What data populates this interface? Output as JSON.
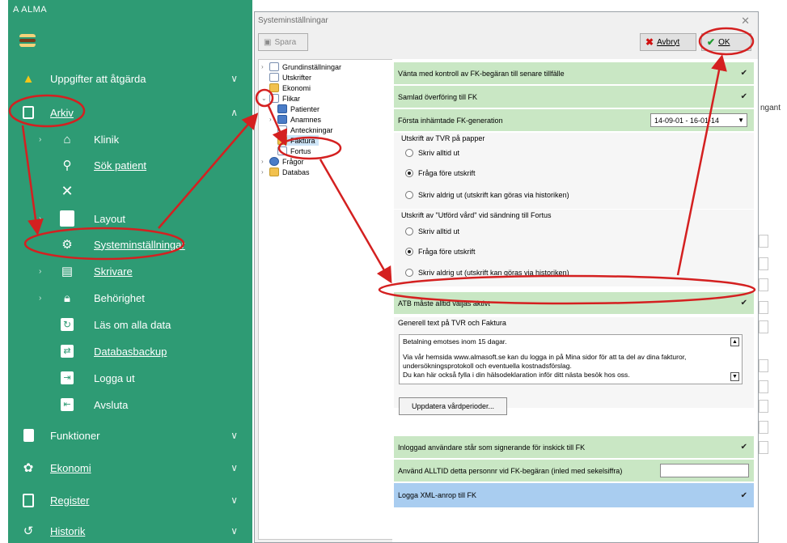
{
  "app": {
    "title": "A  ALMA"
  },
  "sidebar": {
    "sections": [
      {
        "label": "Uppgifter att åtgärda",
        "icon": "warning-icon"
      },
      {
        "label": "Arkiv",
        "icon": "archive-icon"
      }
    ],
    "arkiv_items": [
      {
        "label": "Klinik",
        "icon": "home-icon"
      },
      {
        "label": "Sök patient",
        "icon": "search-icon"
      },
      {
        "label": "",
        "icon": "close-icon"
      },
      {
        "label": "Layout",
        "icon": "layout-icon"
      },
      {
        "label": "Systeminställningar",
        "icon": "gear-icon"
      },
      {
        "label": "Skrivare",
        "icon": "printer-icon"
      },
      {
        "label": "Behörighet",
        "icon": "lock-icon"
      },
      {
        "label": "Läs om alla data",
        "icon": "refresh-icon"
      },
      {
        "label": "Databasbackup",
        "icon": "backup-icon"
      },
      {
        "label": "Logga ut",
        "icon": "logout-icon"
      },
      {
        "label": "Avsluta",
        "icon": "exit-icon"
      }
    ],
    "bottom_sections": [
      {
        "label": "Funktioner",
        "icon": "functions-icon"
      },
      {
        "label": "Ekonomi",
        "icon": "economy-icon"
      },
      {
        "label": "Register",
        "icon": "register-icon"
      },
      {
        "label": "Historik",
        "icon": "history-icon"
      }
    ]
  },
  "dialog": {
    "title": "Systeminställningar",
    "save_label": "Spara",
    "cancel_label": "Avbryt",
    "ok_label": "OK",
    "tree": [
      {
        "label": "Grundinställningar"
      },
      {
        "label": "Utskrifter"
      },
      {
        "label": "Ekonomi"
      },
      {
        "label": "Flikar"
      },
      {
        "label": "Patienter"
      },
      {
        "label": "Anamnes"
      },
      {
        "label": "Anteckningar"
      },
      {
        "label": "Faktura"
      },
      {
        "label": "Fortus"
      },
      {
        "label": "Frågor"
      },
      {
        "label": "Databas"
      }
    ],
    "settings": {
      "r1": "Vänta med kontroll av FK-begäran till senare tillfälle",
      "r2": "Samlad överföring till FK",
      "r3": "Första inhämtade FK-generation",
      "r3_value": "14-09-01 - 16-01-14",
      "group1_title": "Utskrift av TVR på papper",
      "opt_always": "Skriv alltid ut",
      "opt_ask": "Fråga före utskrift",
      "opt_never_hist": "Skriv aldrig ut (utskrift kan göras via historiken)",
      "group2_title": "Utskrift av \"Utförd vård\" vid sändning till Fortus",
      "opt2_always": "Skriv alltid ut",
      "opt2_ask": "Fråga före utskrift",
      "opt2_never_hist": "Skriv aldrig ut (utskrift kan göras via historiken)",
      "r_atb": "ATB måste alltid väljas aktivt",
      "generell_title": "Generell text på TVR och Faktura",
      "generell_text_1": "Betalning emotses inom 15 dagar.",
      "generell_text_2": "Via vår hemsida www.almasoft.se kan du logga in på Mina sidor för att ta del av dina fakturor, undersökningsprotokoll och eventuella kostnadsförslag.",
      "generell_text_3": "Du kan här också fylla i din hälsodeklaration inför ditt nästa besök hos oss.",
      "update_button": "Uppdatera vårdperioder...",
      "r_inloggad": "Inloggad användare står som signerande för inskick till FK",
      "r_pnr": "Använd ALLTID detta personnr vid FK-begäran (inled med sekelsiffra)",
      "r_xml": "Logga XML-anrop till FK"
    }
  },
  "background": {
    "partial_text": "ngant"
  },
  "colors": {
    "sidebar": "#2e9b74",
    "highlight_green": "#c9e7c4",
    "highlight_blue": "#a9cdf0",
    "annotation": "#d42020"
  }
}
